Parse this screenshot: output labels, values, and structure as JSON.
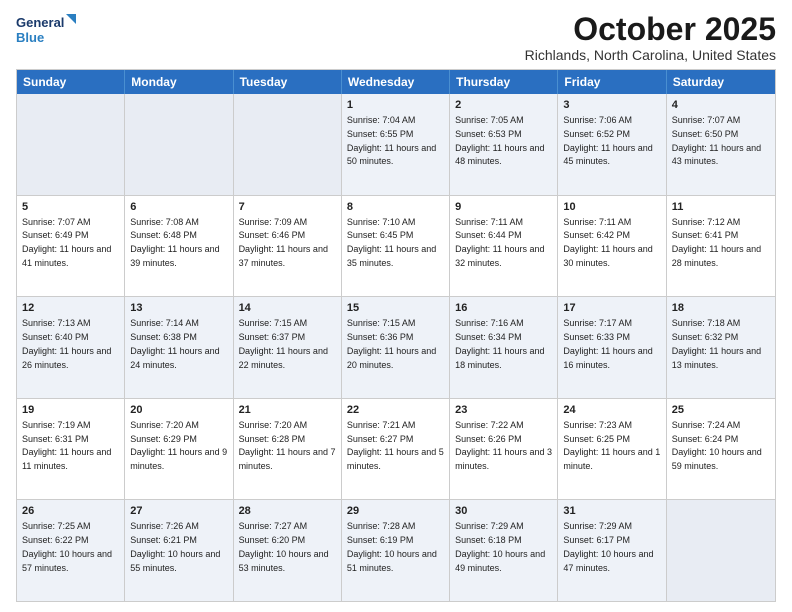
{
  "logo": {
    "line1": "General",
    "line2": "Blue"
  },
  "title": "October 2025",
  "location": "Richlands, North Carolina, United States",
  "days_of_week": [
    "Sunday",
    "Monday",
    "Tuesday",
    "Wednesday",
    "Thursday",
    "Friday",
    "Saturday"
  ],
  "weeks": [
    [
      {
        "day": "",
        "info": ""
      },
      {
        "day": "",
        "info": ""
      },
      {
        "day": "",
        "info": ""
      },
      {
        "day": "1",
        "info": "Sunrise: 7:04 AM\nSunset: 6:55 PM\nDaylight: 11 hours and 50 minutes."
      },
      {
        "day": "2",
        "info": "Sunrise: 7:05 AM\nSunset: 6:53 PM\nDaylight: 11 hours and 48 minutes."
      },
      {
        "day": "3",
        "info": "Sunrise: 7:06 AM\nSunset: 6:52 PM\nDaylight: 11 hours and 45 minutes."
      },
      {
        "day": "4",
        "info": "Sunrise: 7:07 AM\nSunset: 6:50 PM\nDaylight: 11 hours and 43 minutes."
      }
    ],
    [
      {
        "day": "5",
        "info": "Sunrise: 7:07 AM\nSunset: 6:49 PM\nDaylight: 11 hours and 41 minutes."
      },
      {
        "day": "6",
        "info": "Sunrise: 7:08 AM\nSunset: 6:48 PM\nDaylight: 11 hours and 39 minutes."
      },
      {
        "day": "7",
        "info": "Sunrise: 7:09 AM\nSunset: 6:46 PM\nDaylight: 11 hours and 37 minutes."
      },
      {
        "day": "8",
        "info": "Sunrise: 7:10 AM\nSunset: 6:45 PM\nDaylight: 11 hours and 35 minutes."
      },
      {
        "day": "9",
        "info": "Sunrise: 7:11 AM\nSunset: 6:44 PM\nDaylight: 11 hours and 32 minutes."
      },
      {
        "day": "10",
        "info": "Sunrise: 7:11 AM\nSunset: 6:42 PM\nDaylight: 11 hours and 30 minutes."
      },
      {
        "day": "11",
        "info": "Sunrise: 7:12 AM\nSunset: 6:41 PM\nDaylight: 11 hours and 28 minutes."
      }
    ],
    [
      {
        "day": "12",
        "info": "Sunrise: 7:13 AM\nSunset: 6:40 PM\nDaylight: 11 hours and 26 minutes."
      },
      {
        "day": "13",
        "info": "Sunrise: 7:14 AM\nSunset: 6:38 PM\nDaylight: 11 hours and 24 minutes."
      },
      {
        "day": "14",
        "info": "Sunrise: 7:15 AM\nSunset: 6:37 PM\nDaylight: 11 hours and 22 minutes."
      },
      {
        "day": "15",
        "info": "Sunrise: 7:15 AM\nSunset: 6:36 PM\nDaylight: 11 hours and 20 minutes."
      },
      {
        "day": "16",
        "info": "Sunrise: 7:16 AM\nSunset: 6:34 PM\nDaylight: 11 hours and 18 minutes."
      },
      {
        "day": "17",
        "info": "Sunrise: 7:17 AM\nSunset: 6:33 PM\nDaylight: 11 hours and 16 minutes."
      },
      {
        "day": "18",
        "info": "Sunrise: 7:18 AM\nSunset: 6:32 PM\nDaylight: 11 hours and 13 minutes."
      }
    ],
    [
      {
        "day": "19",
        "info": "Sunrise: 7:19 AM\nSunset: 6:31 PM\nDaylight: 11 hours and 11 minutes."
      },
      {
        "day": "20",
        "info": "Sunrise: 7:20 AM\nSunset: 6:29 PM\nDaylight: 11 hours and 9 minutes."
      },
      {
        "day": "21",
        "info": "Sunrise: 7:20 AM\nSunset: 6:28 PM\nDaylight: 11 hours and 7 minutes."
      },
      {
        "day": "22",
        "info": "Sunrise: 7:21 AM\nSunset: 6:27 PM\nDaylight: 11 hours and 5 minutes."
      },
      {
        "day": "23",
        "info": "Sunrise: 7:22 AM\nSunset: 6:26 PM\nDaylight: 11 hours and 3 minutes."
      },
      {
        "day": "24",
        "info": "Sunrise: 7:23 AM\nSunset: 6:25 PM\nDaylight: 11 hours and 1 minute."
      },
      {
        "day": "25",
        "info": "Sunrise: 7:24 AM\nSunset: 6:24 PM\nDaylight: 10 hours and 59 minutes."
      }
    ],
    [
      {
        "day": "26",
        "info": "Sunrise: 7:25 AM\nSunset: 6:22 PM\nDaylight: 10 hours and 57 minutes."
      },
      {
        "day": "27",
        "info": "Sunrise: 7:26 AM\nSunset: 6:21 PM\nDaylight: 10 hours and 55 minutes."
      },
      {
        "day": "28",
        "info": "Sunrise: 7:27 AM\nSunset: 6:20 PM\nDaylight: 10 hours and 53 minutes."
      },
      {
        "day": "29",
        "info": "Sunrise: 7:28 AM\nSunset: 6:19 PM\nDaylight: 10 hours and 51 minutes."
      },
      {
        "day": "30",
        "info": "Sunrise: 7:29 AM\nSunset: 6:18 PM\nDaylight: 10 hours and 49 minutes."
      },
      {
        "day": "31",
        "info": "Sunrise: 7:29 AM\nSunset: 6:17 PM\nDaylight: 10 hours and 47 minutes."
      },
      {
        "day": "",
        "info": ""
      }
    ]
  ],
  "alt_rows": [
    0,
    2,
    4
  ]
}
